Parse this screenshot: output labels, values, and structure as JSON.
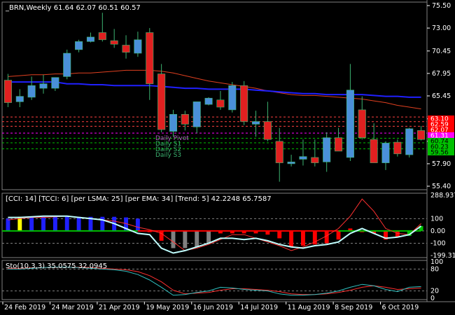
{
  "main": {
    "title": "_BRN,Weekly  61.64 62.07 60.51 60.57",
    "price_axis": [
      "75.50",
      "73.00",
      "70.45",
      "67.95",
      "65.45",
      "62.90",
      "60.40",
      "57.90",
      "55.40"
    ],
    "level_tags": [
      {
        "text": "63.10",
        "bg": "#ff0000",
        "fg": "#ffffff"
      },
      {
        "text": "62.59",
        "bg": "#ff0000",
        "fg": "#ffffff"
      },
      {
        "text": "62.07",
        "bg": "#ff0000",
        "fg": "#ffffff"
      },
      {
        "text": "61.31",
        "bg": "#ff00ff",
        "fg": "#ffffff"
      },
      {
        "text": "60.74",
        "bg": "#00c000",
        "fg": "#000000"
      },
      {
        "text": "60.23",
        "bg": "#00c000",
        "fg": "#000000"
      },
      {
        "text": "59.56",
        "bg": "#00c000",
        "fg": "#000000"
      }
    ],
    "pivot_labels": [
      "Daily Pivot",
      "Daily S1",
      "Daily S2",
      "Daily S3"
    ],
    "colors": {
      "bull": "#4a90d9",
      "bear": "#e02020",
      "wick": "#3cb371",
      "ma_blue": "#2020ff",
      "ma_red": "#e04020"
    }
  },
  "cci_panel": {
    "title": "[CCI: 14] [TCCI: 6] [per LSMA: 25] [per EMA: 34] [Trend: 5]  42.2248 65.7587",
    "axis": [
      "288.9375",
      "100",
      "0.00",
      "-100",
      "-199.319"
    ]
  },
  "sto_panel": {
    "title": "Sto(10,3,3) 35.0575 32.0945",
    "axis": [
      "100",
      "80",
      "20",
      "0"
    ]
  },
  "time_axis": [
    "24 Feb 2019",
    "24 Mar 2019",
    "21 Apr 2019",
    "19 May 2019",
    "16 Jun 2019",
    "14 Jul 2019",
    "11 Aug 2019",
    "8 Sep 2019",
    "6 Oct 2019"
  ],
  "chart_data": {
    "type": "candlestick",
    "timeframe": "Weekly",
    "symbol": "_BRN",
    "ylim": [
      55.4,
      75.5
    ],
    "candles": [
      {
        "o": 67.2,
        "h": 67.9,
        "l": 64.2,
        "c": 64.7
      },
      {
        "o": 64.8,
        "h": 66.2,
        "l": 64.2,
        "c": 65.4
      },
      {
        "o": 65.3,
        "h": 67.6,
        "l": 65.0,
        "c": 66.6
      },
      {
        "o": 66.3,
        "h": 67.8,
        "l": 65.7,
        "c": 66.8
      },
      {
        "o": 66.3,
        "h": 67.5,
        "l": 66.0,
        "c": 67.5
      },
      {
        "o": 67.6,
        "h": 70.6,
        "l": 67.3,
        "c": 70.2
      },
      {
        "o": 70.6,
        "h": 71.7,
        "l": 70.3,
        "c": 71.5
      },
      {
        "o": 71.5,
        "h": 72.5,
        "l": 71.4,
        "c": 72.0
      },
      {
        "o": 72.5,
        "h": 74.7,
        "l": 71.5,
        "c": 71.7
      },
      {
        "o": 71.6,
        "h": 72.9,
        "l": 70.8,
        "c": 71.2
      },
      {
        "o": 71.1,
        "h": 72.2,
        "l": 69.6,
        "c": 70.3
      },
      {
        "o": 70.2,
        "h": 72.6,
        "l": 69.8,
        "c": 71.7
      },
      {
        "o": 72.5,
        "h": 73.0,
        "l": 65.0,
        "c": 66.8
      },
      {
        "o": 67.9,
        "h": 69.0,
        "l": 61.4,
        "c": 61.7
      },
      {
        "o": 61.5,
        "h": 63.9,
        "l": 60.9,
        "c": 63.4
      },
      {
        "o": 63.4,
        "h": 63.8,
        "l": 61.6,
        "c": 62.3
      },
      {
        "o": 62.0,
        "h": 64.6,
        "l": 61.3,
        "c": 64.8
      },
      {
        "o": 64.5,
        "h": 65.3,
        "l": 64.4,
        "c": 65.2
      },
      {
        "o": 65.0,
        "h": 66.0,
        "l": 63.9,
        "c": 64.2
      },
      {
        "o": 63.9,
        "h": 67.0,
        "l": 63.6,
        "c": 66.6
      },
      {
        "o": 66.6,
        "h": 67.1,
        "l": 62.2,
        "c": 62.6
      },
      {
        "o": 62.3,
        "h": 63.8,
        "l": 60.9,
        "c": 62.6
      },
      {
        "o": 62.6,
        "h": 64.8,
        "l": 60.4,
        "c": 60.6
      },
      {
        "o": 60.4,
        "h": 61.9,
        "l": 55.9,
        "c": 58.0
      },
      {
        "o": 57.9,
        "h": 58.9,
        "l": 57.6,
        "c": 58.1
      },
      {
        "o": 58.4,
        "h": 60.6,
        "l": 57.7,
        "c": 58.7
      },
      {
        "o": 58.6,
        "h": 60.6,
        "l": 57.6,
        "c": 58.0
      },
      {
        "o": 58.1,
        "h": 61.4,
        "l": 57.0,
        "c": 60.8
      },
      {
        "o": 60.8,
        "h": 61.9,
        "l": 59.4,
        "c": 59.3
      },
      {
        "o": 58.6,
        "h": 69.0,
        "l": 58.2,
        "c": 66.1
      },
      {
        "o": 63.9,
        "h": 65.4,
        "l": 60.6,
        "c": 60.8
      },
      {
        "o": 60.6,
        "h": 62.4,
        "l": 58.1,
        "c": 58.0
      },
      {
        "o": 58.0,
        "h": 60.4,
        "l": 57.2,
        "c": 60.2
      },
      {
        "o": 60.3,
        "h": 60.6,
        "l": 58.7,
        "c": 59.0
      },
      {
        "o": 58.9,
        "h": 61.9,
        "l": 58.6,
        "c": 61.8
      },
      {
        "o": 61.6,
        "h": 62.1,
        "l": 60.5,
        "c": 60.6
      }
    ],
    "ma_blue": [
      67.0,
      67.0,
      67.0,
      67.0,
      67.0,
      66.8,
      66.8,
      66.7,
      66.7,
      66.6,
      66.6,
      66.6,
      66.6,
      66.5,
      66.4,
      66.3,
      66.3,
      66.2,
      66.2,
      66.2,
      66.2,
      66.1,
      66.0,
      65.9,
      65.8,
      65.7,
      65.7,
      65.6,
      65.6,
      65.6,
      65.6,
      65.5,
      65.4,
      65.4,
      65.3,
      65.3
    ],
    "ma_red": [
      67.6,
      67.7,
      67.8,
      67.8,
      67.9,
      67.9,
      68.0,
      68.0,
      68.1,
      68.2,
      68.3,
      68.3,
      68.3,
      68.2,
      68.0,
      67.7,
      67.4,
      67.1,
      66.9,
      66.7,
      66.5,
      66.3,
      66.0,
      65.8,
      65.6,
      65.5,
      65.5,
      65.4,
      65.3,
      65.2,
      65.1,
      64.9,
      64.7,
      64.4,
      64.2,
      64.0
    ],
    "levels": [
      63.1,
      62.59,
      62.07,
      61.31,
      60.74,
      60.23,
      59.56
    ],
    "cci": {
      "ylim": [
        -200,
        290
      ],
      "hist": [
        100,
        115,
        115,
        115,
        115,
        115,
        115,
        115,
        115,
        115,
        110,
        100,
        -10,
        -80,
        -140,
        -140,
        -130,
        -100,
        -20,
        -20,
        -20,
        -20,
        -30,
        -60,
        -130,
        -120,
        -110,
        -100,
        -70,
        20,
        -10,
        -20,
        -70,
        -50,
        -40,
        40
      ],
      "hist_colors": [
        "#2020ff",
        "#ffff00",
        "#2020ff",
        "#2020ff",
        "#2020ff",
        "#2020ff",
        "#2020ff",
        "#2020ff",
        "#2020ff",
        "#2020ff",
        "#2020ff",
        "#2020ff",
        "#ff0000",
        "#ff0000",
        "#808080",
        "#808080",
        "#808080",
        "#808080",
        "#ff0000",
        "#ff0000",
        "#ff0000",
        "#ff0000",
        "#ff0000",
        "#ff0000",
        "#ff0000",
        "#ff0000",
        "#ff0000",
        "#ff0000",
        "#ff0000",
        "#ff0000",
        "#ff0000",
        "#ff0000",
        "#ff0000",
        "#ff0000",
        "#00c000",
        "#00c000"
      ],
      "cyan": [
        110,
        110,
        115,
        120,
        120,
        120,
        110,
        100,
        90,
        60,
        20,
        -20,
        -30,
        -140,
        -180,
        -160,
        -130,
        -100,
        -60,
        -60,
        -70,
        -60,
        -80,
        -110,
        -130,
        -140,
        -120,
        -110,
        -90,
        -20,
        20,
        -20,
        -60,
        -50,
        -30,
        40
      ],
      "red": [
        90,
        100,
        110,
        110,
        115,
        120,
        110,
        100,
        90,
        80,
        60,
        30,
        10,
        -20,
        -90,
        -160,
        -140,
        -110,
        -70,
        -30,
        -30,
        -60,
        -90,
        -120,
        -160,
        -130,
        -90,
        -40,
        20,
        120,
        260,
        160,
        20,
        -20,
        -30,
        60
      ]
    },
    "sto": {
      "ylim": [
        0,
        100
      ],
      "main": [
        80,
        80,
        82,
        84,
        85,
        85,
        84,
        82,
        80,
        78,
        74,
        65,
        50,
        30,
        8,
        10,
        16,
        20,
        30,
        28,
        24,
        22,
        20,
        12,
        8,
        8,
        10,
        14,
        20,
        30,
        38,
        34,
        24,
        18,
        30,
        32
      ],
      "signal": [
        82,
        82,
        83,
        84,
        84,
        85,
        85,
        84,
        82,
        80,
        78,
        73,
        62,
        45,
        22,
        12,
        14,
        16,
        22,
        26,
        26,
        24,
        22,
        18,
        12,
        10,
        10,
        12,
        16,
        22,
        30,
        34,
        30,
        24,
        26,
        28
      ]
    }
  }
}
